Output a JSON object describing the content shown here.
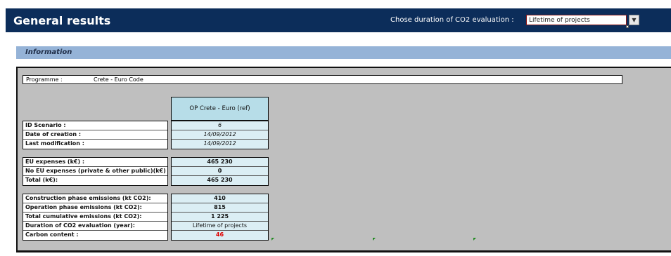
{
  "header": {
    "title": "General results",
    "duration_label": "Chose duration of CO2 evaluation :",
    "duration_value": "Lifetime of projects"
  },
  "info_section": {
    "label": "Information"
  },
  "programme": {
    "label": "Programme :",
    "value": "Crete - Euro Code"
  },
  "scenario_column": "OP Crete - Euro (ref)",
  "groups": [
    {
      "rows": [
        {
          "label": "ID Scenario :",
          "value": "6"
        },
        {
          "label": "Date of creation :",
          "value": "14/09/2012"
        },
        {
          "label": "Last modification :",
          "value": "14/09/2012"
        }
      ]
    },
    {
      "rows": [
        {
          "label": "EU expenses (k€) :",
          "value": "465 230"
        },
        {
          "label": "No EU expenses (private & other public)(k€) :",
          "value": "0"
        },
        {
          "label": "Total (k€):",
          "value": "465 230"
        }
      ]
    },
    {
      "rows": [
        {
          "label": "Construction phase emissions (kt CO2):",
          "value": "410"
        },
        {
          "label": "Operation phase emissions (kt CO2):",
          "value": "815"
        },
        {
          "label": "Total cumulative emissions (kt CO2):",
          "value": "1 225"
        },
        {
          "label": "Duration of CO2 evaluation (year):",
          "value": "Lifetime of projects"
        },
        {
          "label": "Carbon content :",
          "value": "46"
        }
      ]
    }
  ],
  "colors": {
    "header_bg": "#0c2d5a",
    "info_bar_bg": "#95b3d7",
    "panel_bg": "#bfbfbf",
    "column_header_bg": "#b7dde8",
    "value_cell_bg": "#dbeef4",
    "carbon_value": "#e00000"
  },
  "icons": {
    "dropdown": "chevron-down-icon",
    "error_marker": "green-triangle-icon"
  }
}
